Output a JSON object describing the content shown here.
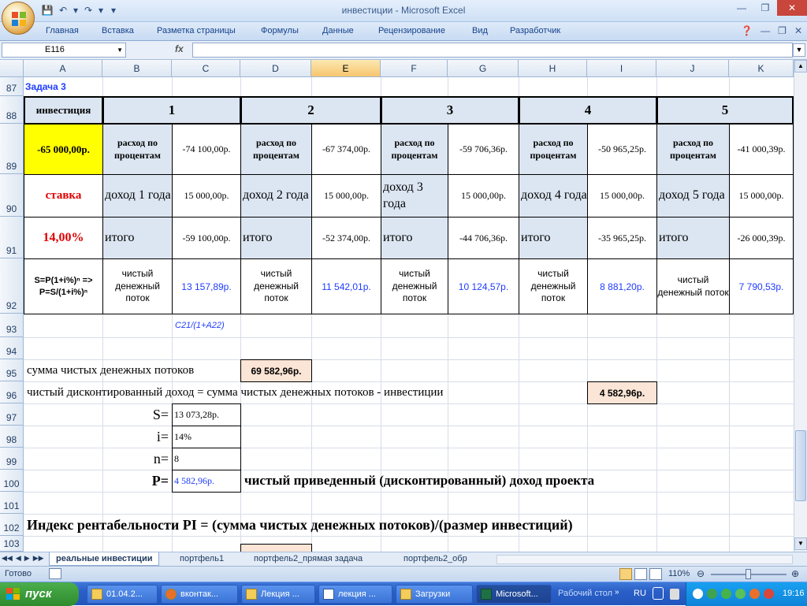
{
  "window": {
    "title": "инвестиции - Microsoft Excel"
  },
  "ribbon": {
    "tabs": [
      "Главная",
      "Вставка",
      "Разметка страницы",
      "Формулы",
      "Данные",
      "Рецензирование",
      "Вид",
      "Разработчик"
    ]
  },
  "formula_bar": {
    "name_box": "E116",
    "fx": "fx",
    "formula": ""
  },
  "columns": [
    "A",
    "B",
    "C",
    "D",
    "E",
    "F",
    "G",
    "H",
    "I",
    "J",
    "K"
  ],
  "selected_column": "E",
  "rows": [
    "87",
    "88",
    "89",
    "90",
    "91",
    "92",
    "93",
    "94",
    "95",
    "96",
    "97",
    "98",
    "99",
    "100",
    "101",
    "102",
    "103"
  ],
  "sheet": {
    "task_title": "Задача 3",
    "invest_label": "инвестиция",
    "periods": [
      "1",
      "2",
      "3",
      "4",
      "5"
    ],
    "invest_value": "-65 000,00р.",
    "rate_label": "ставка",
    "rate_value": "14,00%",
    "formula_note": "S=P(1+i%)ⁿ => P=S/(1+i%)ⁿ",
    "expense_label": "расход по процентам",
    "total_label": "итого",
    "cashflow_label": "чистый денежный поток",
    "expenses": [
      "-74 100,00р.",
      "-67 374,00р.",
      "-59 706,36р.",
      "-50 965,25р.",
      "-41 000,39р."
    ],
    "income_labels": [
      "доход 1 года",
      "доход 2 года",
      "доход 3 года",
      "доход 4 года",
      "доход 5 года"
    ],
    "incomes": [
      "15 000,00р.",
      "15 000,00р.",
      "15 000,00р.",
      "15 000,00р.",
      "15 000,00р."
    ],
    "totals": [
      "-59 100,00р.",
      "-52 374,00р.",
      "-44 706,36р.",
      "-35 965,25р.",
      "-26 000,39р."
    ],
    "cashflows": [
      "13 157,89р.",
      "11 542,01р.",
      "10 124,57р.",
      "8 881,20р.",
      "7 790,53р."
    ],
    "c93_formula": "C21/(1+A22)",
    "sum_label": "сумма чистых денежных потоков",
    "sum_value": "69 582,96р.",
    "npv_label": "чистый дисконтированный доход = сумма чистых денежных потоков - инвестиции",
    "npv_value": "4 582,96р.",
    "s_label": "S=",
    "s_value": "13 073,28р.",
    "i_label": "i=",
    "i_value": "14%",
    "n_label": "n=",
    "n_value": "8",
    "p_label": "P=",
    "p_value": "4 582,96р.",
    "p_desc": "чистый приведенный (дисконтированный) доход проекта",
    "pi_title": "Индекс рентабельности PI = (сумма чистых денежных потоков)/(размер инвестиций)"
  },
  "sheet_tabs": [
    "реальные инвестиции",
    "портфель1",
    "портфель2_прямая задача",
    "портфель2_обр"
  ],
  "status": {
    "ready": "Готово",
    "zoom": "110%"
  },
  "taskbar": {
    "start": "пуск",
    "items": [
      "01.04.2...",
      "вконтак...",
      "Лекция ...",
      "лекция ...",
      "Загрузки",
      "Microsoft..."
    ],
    "desktop": "Рабочий стол",
    "lang": "RU",
    "time": "19:16"
  },
  "colors": {
    "yellow": "#ffff00",
    "header_fill": "#dce6f2",
    "peach": "#fbe5d6",
    "blue_text": "#1f3cff",
    "red_text": "#e00000"
  }
}
